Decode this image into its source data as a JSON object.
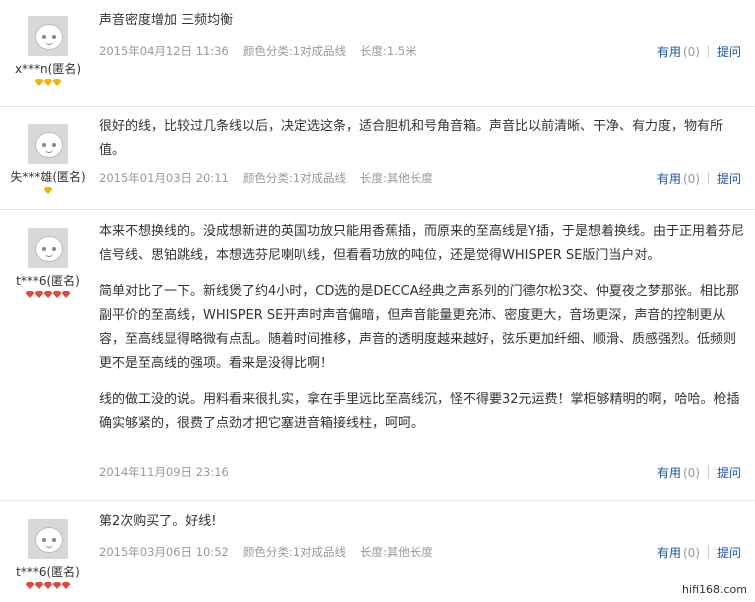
{
  "reviews": [
    {
      "user": "x***n(匿名)",
      "level_color": "yellow",
      "level_count": 3,
      "paragraphs": [
        "声音密度增加 三频均衡"
      ],
      "date": "2015年04月12日 11:36",
      "color": "颜色分类:1对成品线",
      "length": "长度:1.5米",
      "useful_label": "有用",
      "useful_count": "(0)",
      "reply_label": "提问"
    },
    {
      "user": "失***雄(匿名)",
      "level_color": "yellow",
      "level_count": 1,
      "paragraphs": [
        "很好的线，比较过几条线以后，决定选这条，适合胆机和号角音箱。声音比以前清晰、干净、有力度，物有所值。"
      ],
      "date": "2015年01月03日 20:11",
      "color": "颜色分类:1对成品线",
      "length": "长度:其他长度",
      "useful_label": "有用",
      "useful_count": "(0)",
      "reply_label": "提问"
    },
    {
      "user": "t***6(匿名)",
      "level_color": "red",
      "level_count": 5,
      "paragraphs": [
        "本来不想换线的。没成想新进的英国功放只能用香蕉插，而原来的至高线是Y插，于是想着换线。由于正用着芬尼信号线、思铂跳线，本想选芬尼喇叭线，但看看功放的吨位，还是觉得WHISPER SE版门当户对。",
        "简单对比了一下。新线煲了约4小时，CD选的是DECCA经典之声系列的门德尔松3交、仲夏夜之梦那张。相比那副平价的至高线，WHISPER SE开声时声音偏暗，但声音能量更充沛、密度更大，音场更深，声音的控制更从容，至高线显得略微有点乱。随着时间推移，声音的透明度越来越好，弦乐更加纤细、顺滑、质感强烈。低频则更不是至高线的强项。看来是没得比啊！",
        "线的做工没的说。用料看来很扎实，拿在手里远比至高线沉，怪不得要32元运费！掌柜够精明的啊，哈哈。枪插确实够紧的，很费了点劲才把它塞进音箱接线柱，呵呵。"
      ],
      "date": "2014年11月09日 23:16",
      "color": "颜色分类:1对成品线",
      "length": "长度:其他长度",
      "useful_label": "有用",
      "useful_count": "(0)",
      "reply_label": "提问"
    },
    {
      "user": "t***6(匿名)",
      "level_color": "red",
      "level_count": 5,
      "paragraphs": [
        "第2次购买了。好线!"
      ],
      "date": "2015年03月06日 10:52",
      "color": "颜色分类:1对成品线",
      "length": "长度:其他长度",
      "useful_label": "有用",
      "useful_count": "(0)",
      "reply_label": "提问"
    }
  ],
  "watermark": "hifi168.com"
}
